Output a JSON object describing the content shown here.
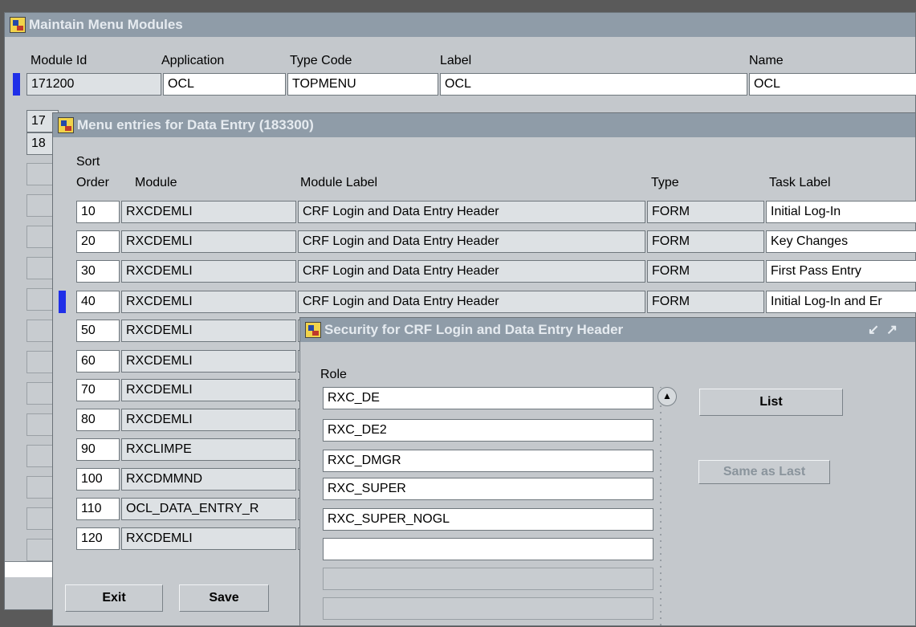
{
  "main_window": {
    "title": "Maintain Menu Modules",
    "columns": {
      "module_id": "Module Id",
      "application": "Application",
      "type_code": "Type Code",
      "label": "Label",
      "name": "Name"
    },
    "current_row": {
      "module_id": "171200",
      "application": "OCL",
      "type_code": "TOPMENU",
      "label": "OCL",
      "name": "OCL"
    },
    "partial_ids": [
      "17",
      "18"
    ]
  },
  "menu_entries": {
    "title": "Menu entries for Data Entry (183300)",
    "columns": {
      "sort_top": "Sort",
      "sort_bottom": "Order",
      "module": "Module",
      "module_label": "Module Label",
      "type": "Type",
      "task_label": "Task Label"
    },
    "rows": [
      {
        "order": "10",
        "module": "RXCDEMLI",
        "module_label": "CRF Login and Data Entry Header",
        "type": "FORM",
        "task_label": "Initial Log-In"
      },
      {
        "order": "20",
        "module": "RXCDEMLI",
        "module_label": "CRF Login and Data Entry Header",
        "type": "FORM",
        "task_label": "Key Changes"
      },
      {
        "order": "30",
        "module": "RXCDEMLI",
        "module_label": "CRF Login and Data Entry Header",
        "type": "FORM",
        "task_label": "First Pass Entry"
      },
      {
        "order": "40",
        "module": "RXCDEMLI",
        "module_label": "CRF Login and Data Entry Header",
        "type": "FORM",
        "task_label": "Initial Log-In and Er"
      },
      {
        "order": "50",
        "module": "RXCDEMLI"
      },
      {
        "order": "60",
        "module": "RXCDEMLI"
      },
      {
        "order": "70",
        "module": "RXCDEMLI"
      },
      {
        "order": "80",
        "module": "RXCDEMLI"
      },
      {
        "order": "90",
        "module": "RXCLIMPE"
      },
      {
        "order": "100",
        "module": "RXCDMMND"
      },
      {
        "order": "110",
        "module": "OCL_DATA_ENTRY_R"
      },
      {
        "order": "120",
        "module": "RXCDEMLI"
      }
    ],
    "buttons": {
      "exit": "Exit",
      "save": "Save"
    }
  },
  "security": {
    "title": "Security for CRF Login and Data Entry Header",
    "role_header": "Role",
    "roles": [
      "RXC_DE",
      "RXC_DE2",
      "RXC_DMGR",
      "RXC_SUPER",
      "RXC_SUPER_NOGL",
      "",
      "",
      ""
    ],
    "buttons": {
      "list": "List",
      "same_as_last": "Same as Last"
    }
  },
  "colors": {
    "title_bar": "#8f9ca8",
    "record_indicator": "#1f2fe8",
    "window_bg": "#c4c8cc"
  }
}
